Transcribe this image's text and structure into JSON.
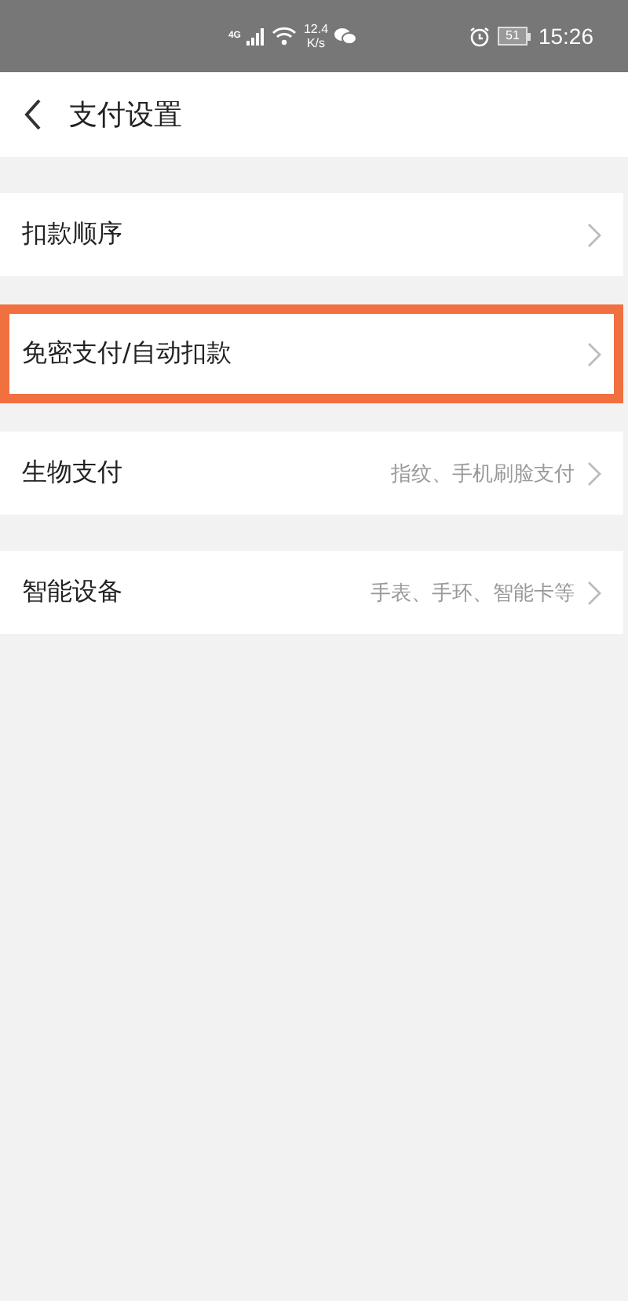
{
  "status_bar": {
    "network": "4G",
    "speed_value": "12.4",
    "speed_unit": "K/s",
    "battery": "51",
    "time": "15:26"
  },
  "header": {
    "title": "支付设置"
  },
  "groups": [
    {
      "title": "扣款顺序",
      "highlighted": false
    },
    {
      "title": "免密支付/自动扣款",
      "highlighted": true
    },
    {
      "title": "生物支付",
      "value": "指纹、手机刷脸支付",
      "highlighted": false
    },
    {
      "title": "智能设备",
      "value": "手表、手环、智能卡等",
      "highlighted": false
    }
  ]
}
